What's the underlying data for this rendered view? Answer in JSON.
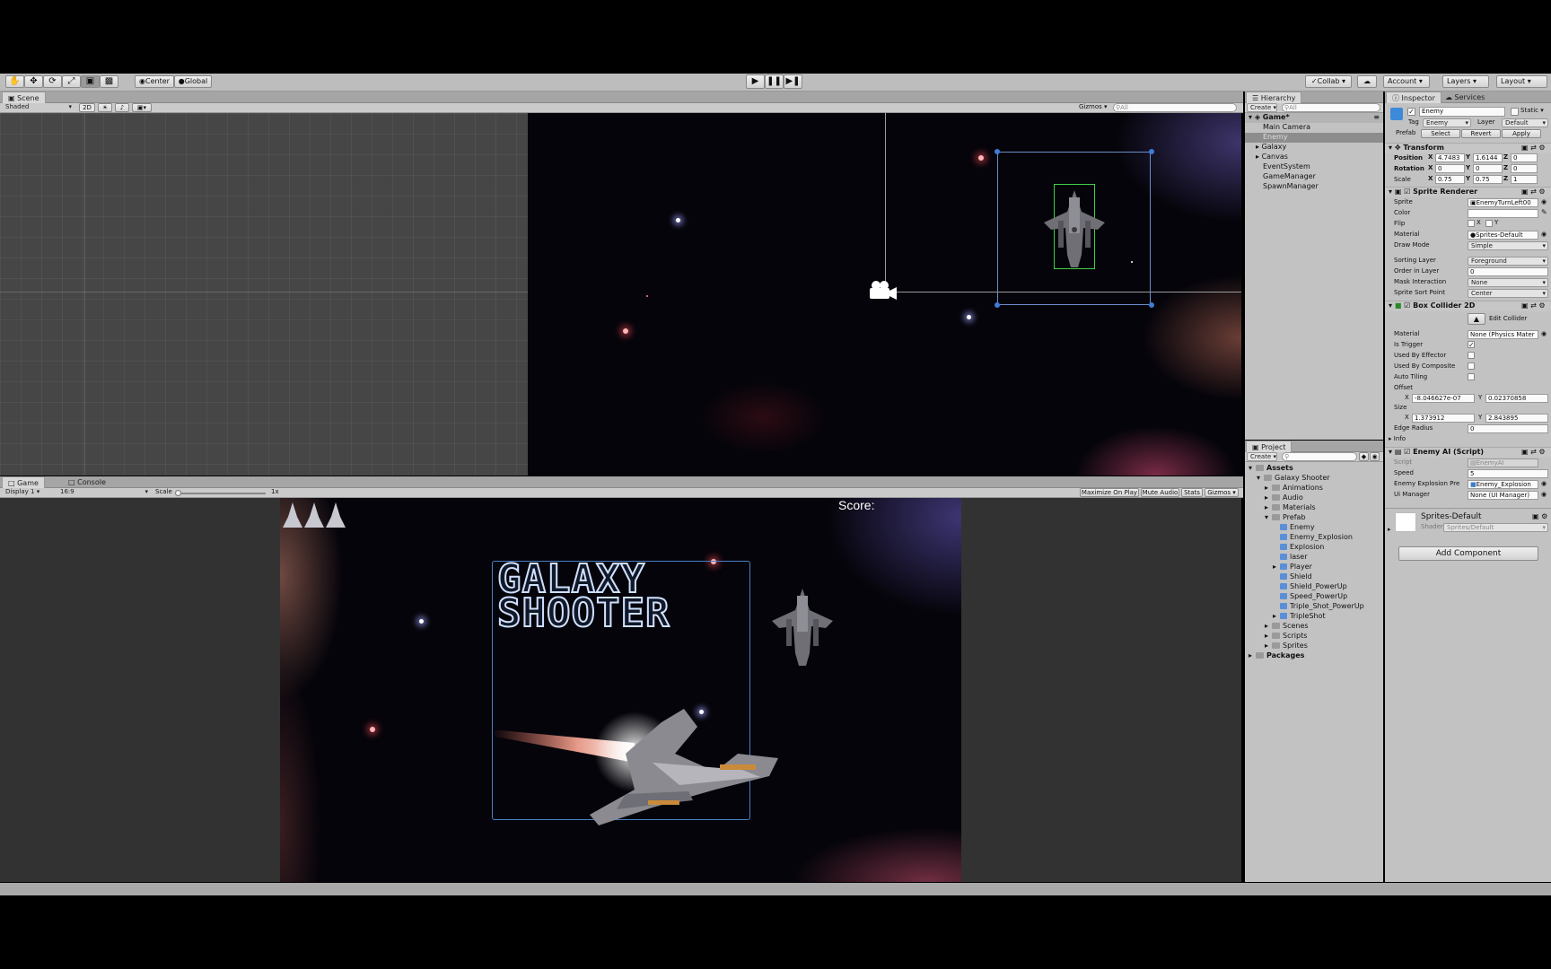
{
  "toolbar": {
    "pivot_label": "Center",
    "space_label": "Global",
    "collab_label": "Collab",
    "account_label": "Account",
    "layers_label": "Layers",
    "layout_label": "Layout"
  },
  "scene": {
    "tab_label": "Scene",
    "shading_mode": "Shaded",
    "mode_2d_label": "2D",
    "gizmos_label": "Gizmos",
    "search_placeholder": "All"
  },
  "game": {
    "tab_label": "Game",
    "console_tab_label": "Console",
    "display_label": "Display 1",
    "aspect_label": "16:9",
    "scale_label": "Scale",
    "scale_value": "1x",
    "maximize_label": "Maximize On Play",
    "mute_label": "Mute Audio",
    "stats_label": "Stats",
    "gizmos_label": "Gizmos",
    "score_label": "Score:",
    "title_line1": "GALAXY",
    "title_line2": "SHOOTER",
    "lives_count": 3
  },
  "hierarchy": {
    "tab_label": "Hierarchy",
    "create_label": "Create",
    "search_placeholder": "All",
    "scene_name": "Game*",
    "items": [
      "Main Camera",
      "Enemy",
      "Galaxy",
      "Canvas",
      "EventSystem",
      "GameManager",
      "SpawnManager"
    ]
  },
  "project": {
    "tab_label": "Project",
    "create_label": "Create",
    "tree": [
      {
        "label": "Assets",
        "type": "folder",
        "level": 0,
        "arrow": "open",
        "bold": true
      },
      {
        "label": "Galaxy Shooter",
        "type": "folder",
        "level": 1,
        "arrow": "open"
      },
      {
        "label": "Animations",
        "type": "folder",
        "level": 2,
        "arrow": "closed"
      },
      {
        "label": "Audio",
        "type": "folder",
        "level": 2,
        "arrow": "closed"
      },
      {
        "label": "Materials",
        "type": "folder",
        "level": 2,
        "arrow": "closed"
      },
      {
        "label": "Prefab",
        "type": "folder",
        "level": 2,
        "arrow": "open"
      },
      {
        "label": "Enemy",
        "type": "prefab",
        "level": 3,
        "arrow": "none"
      },
      {
        "label": "Enemy_Explosion",
        "type": "prefab",
        "level": 3,
        "arrow": "none"
      },
      {
        "label": "Explosion",
        "type": "prefab",
        "level": 3,
        "arrow": "none"
      },
      {
        "label": "laser",
        "type": "prefab",
        "level": 3,
        "arrow": "none"
      },
      {
        "label": "Player",
        "type": "prefab",
        "level": 3,
        "arrow": "closed"
      },
      {
        "label": "Shield",
        "type": "prefab",
        "level": 3,
        "arrow": "none"
      },
      {
        "label": "Shield_PowerUp",
        "type": "prefab",
        "level": 3,
        "arrow": "none"
      },
      {
        "label": "Speed_PowerUp",
        "type": "prefab",
        "level": 3,
        "arrow": "none"
      },
      {
        "label": "Triple_Shot_PowerUp",
        "type": "prefab",
        "level": 3,
        "arrow": "none"
      },
      {
        "label": "TripleShot",
        "type": "prefab",
        "level": 3,
        "arrow": "closed"
      },
      {
        "label": "Scenes",
        "type": "folder",
        "level": 2,
        "arrow": "closed"
      },
      {
        "label": "Scripts",
        "type": "folder",
        "level": 2,
        "arrow": "closed"
      },
      {
        "label": "Sprites",
        "type": "folder",
        "level": 2,
        "arrow": "closed"
      },
      {
        "label": "Packages",
        "type": "folder",
        "level": 0,
        "arrow": "closed",
        "bold": true
      }
    ]
  },
  "inspector": {
    "tab_label": "Inspector",
    "services_tab_label": "Services",
    "object_name": "Enemy",
    "static_label": "Static",
    "tag_label": "Tag",
    "tag_value": "Enemy",
    "layer_label": "Layer",
    "layer_value": "Default",
    "prefab_label": "Prefab",
    "select_label": "Select",
    "revert_label": "Revert",
    "apply_label": "Apply",
    "transform": {
      "title": "Transform",
      "position_label": "Position",
      "rotation_label": "Rotation",
      "scale_label": "Scale",
      "position": [
        "4.7483",
        "1.6144",
        "0"
      ],
      "rotation": [
        "0",
        "0",
        "0"
      ],
      "scale": [
        "0.75",
        "0.75",
        "1"
      ]
    },
    "sprite_renderer": {
      "title": "Sprite Renderer",
      "sprite_label": "Sprite",
      "sprite_value": "EnemyTurnLeft00",
      "color_label": "Color",
      "flip_label": "Flip",
      "flip_x": "X",
      "flip_y": "Y",
      "material_label": "Material",
      "material_value": "Sprites-Default",
      "draw_mode_label": "Draw Mode",
      "draw_mode_value": "Simple",
      "sorting_layer_label": "Sorting Layer",
      "sorting_layer_value": "Foreground",
      "order_label": "Order in Layer",
      "order_value": "0",
      "mask_label": "Mask Interaction",
      "mask_value": "None",
      "sort_point_label": "Sprite Sort Point",
      "sort_point_value": "Center"
    },
    "box_collider": {
      "title": "Box Collider 2D",
      "edit_label": "Edit Collider",
      "material_label": "Material",
      "material_value": "None (Physics Mater",
      "is_trigger_label": "Is Trigger",
      "is_trigger": true,
      "effector_label": "Used By Effector",
      "composite_label": "Used By Composite",
      "auto_tiling_label": "Auto Tiling",
      "offset_label": "Offset",
      "offset_x": "-8.046627e-07",
      "offset_y": "0.02370858",
      "size_label": "Size",
      "size_x": "1.373912",
      "size_y": "2.843895",
      "edge_label": "Edge Radius",
      "edge_value": "0",
      "info_label": "Info"
    },
    "enemy_ai": {
      "title": "Enemy AI (Script)",
      "script_label": "Script",
      "script_value": "EnemyAI",
      "speed_label": "Speed",
      "speed_value": "5",
      "explosion_label": "Enemy Explosion Pre",
      "explosion_value": "Enemy_Explosion",
      "ui_label": "Ui Manager",
      "ui_value": "None (UI Manager)"
    },
    "material": {
      "name": "Sprites-Default",
      "shader_label": "Shader",
      "shader_value": "Sprites/Default"
    },
    "add_component_label": "Add Component"
  }
}
